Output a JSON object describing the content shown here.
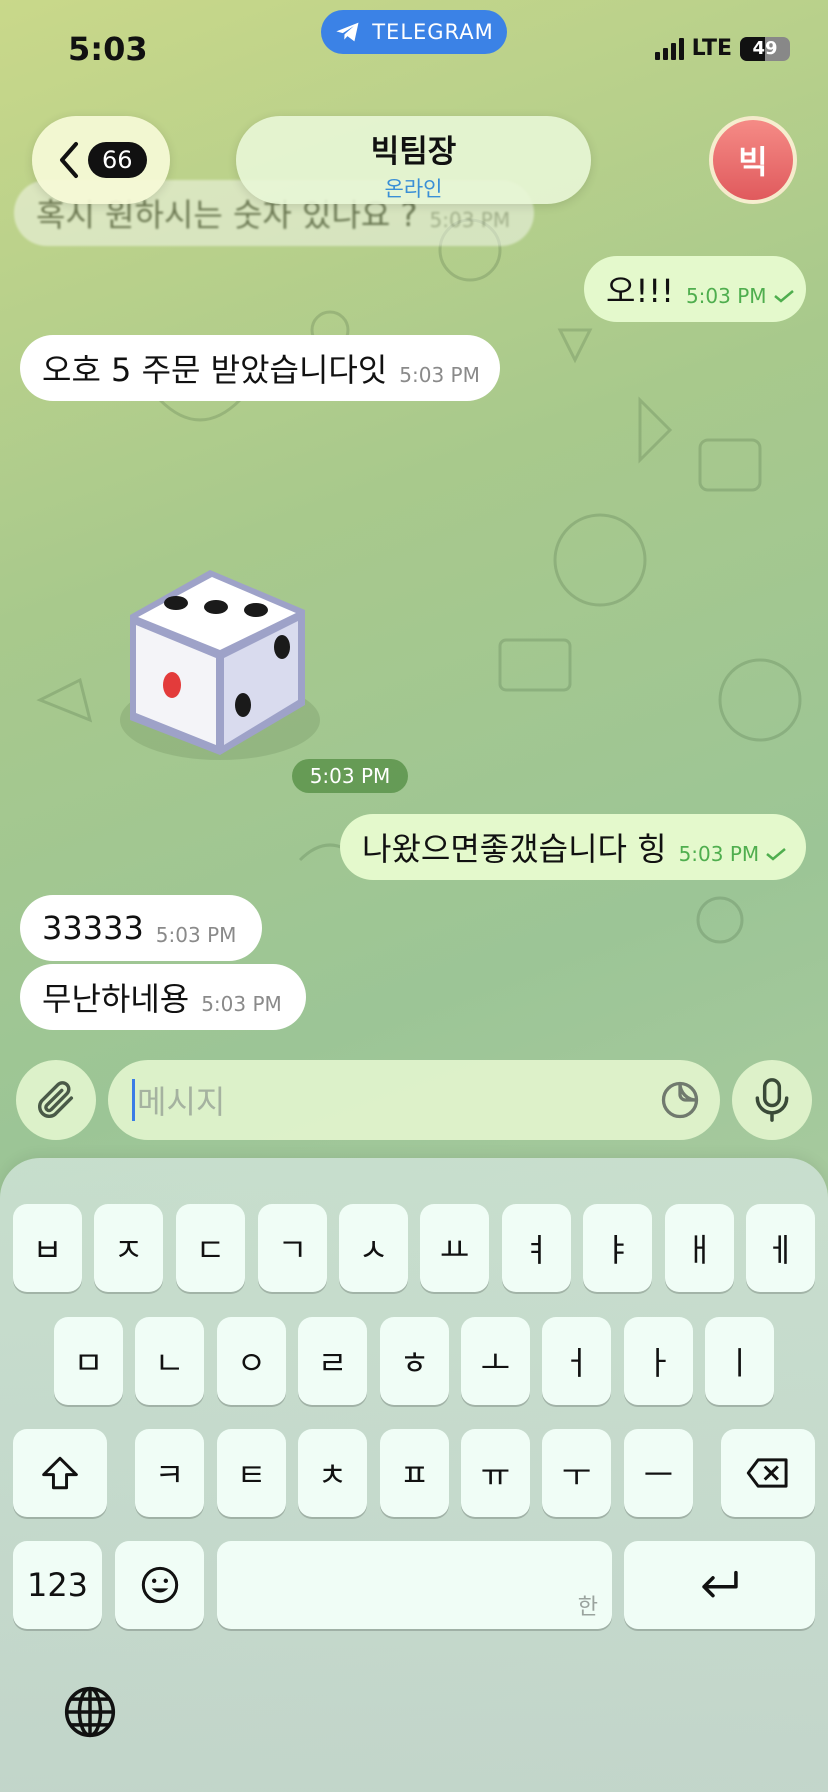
{
  "status_bar": {
    "time": "5:03",
    "app_pill": "TELEGRAM",
    "network": "LTE",
    "battery": "49",
    "battery_level": 0.49
  },
  "header": {
    "unread_count": "66",
    "chat_name": "빅팀장",
    "chat_status": "온라인",
    "avatar_initial": "빅"
  },
  "messages": {
    "faded_top": {
      "text": "혹시 원하시는 숫자 있나요 ?",
      "time": "5:03 PM"
    },
    "m1": {
      "text": "오!!!",
      "time": "5:03 PM"
    },
    "m2": {
      "text": "오호 5 주문 받았습니다잇",
      "time": "5:03 PM"
    },
    "dice_time": "5:03 PM",
    "m3": {
      "text": "나왔으면좋갰습니다 힝",
      "time": "5:03 PM"
    },
    "m4": {
      "text": "33333",
      "time": "5:03 PM"
    },
    "m5": {
      "text": "무난하네용",
      "time": "5:03 PM"
    }
  },
  "input": {
    "placeholder": "메시지"
  },
  "keyboard": {
    "row1": [
      "ㅂ",
      "ㅈ",
      "ㄷ",
      "ㄱ",
      "ㅅ",
      "ㅛ",
      "ㅕ",
      "ㅑ",
      "ㅐ",
      "ㅔ"
    ],
    "row2": [
      "ㅁ",
      "ㄴ",
      "ㅇ",
      "ㄹ",
      "ㅎ",
      "ㅗ",
      "ㅓ",
      "ㅏ",
      "ㅣ"
    ],
    "row3": [
      "ㅋ",
      "ㅌ",
      "ㅊ",
      "ㅍ",
      "ㅠ",
      "ㅜ",
      "ㅡ"
    ],
    "numbers_key": "123",
    "space_hint": "한"
  },
  "colors": {
    "outgoing_bubble": "#e4f9cc",
    "incoming_bubble": "#ffffff",
    "accent_blue": "#3b82e6",
    "avatar_red": "#e05a5d"
  }
}
